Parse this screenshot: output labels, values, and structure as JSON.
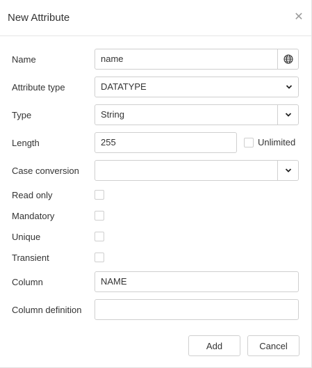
{
  "dialog": {
    "title": "New Attribute",
    "close_icon": "close-icon"
  },
  "form": {
    "name": {
      "label": "Name",
      "value": "name",
      "addon_icon": "globe-icon"
    },
    "attribute_type": {
      "label": "Attribute type",
      "value": "DATATYPE"
    },
    "type": {
      "label": "Type",
      "value": "String"
    },
    "length": {
      "label": "Length",
      "value": "255",
      "unlimited_label": "Unlimited",
      "unlimited_checked": false
    },
    "case_conversion": {
      "label": "Case conversion",
      "value": ""
    },
    "read_only": {
      "label": "Read only",
      "checked": false
    },
    "mandatory": {
      "label": "Mandatory",
      "checked": false
    },
    "unique": {
      "label": "Unique",
      "checked": false
    },
    "transient": {
      "label": "Transient",
      "checked": false
    },
    "column": {
      "label": "Column",
      "value": "NAME"
    },
    "column_definition": {
      "label": "Column definition",
      "value": ""
    }
  },
  "buttons": {
    "add": "Add",
    "cancel": "Cancel"
  }
}
